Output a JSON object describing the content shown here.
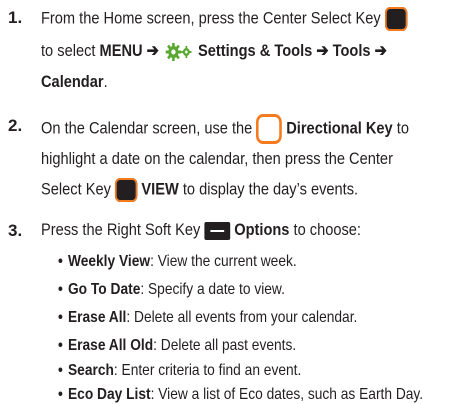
{
  "steps": [
    {
      "number": "1.",
      "pre": "From the Home screen, press the Center Select Key",
      "to_select": "to select",
      "menu": "MENU",
      "arrow": "➔",
      "settings": "Settings & Tools",
      "tools": "Tools",
      "calendar": "Calendar",
      "period": "."
    },
    {
      "number": "2.",
      "pre": "On the Calendar screen, use the",
      "directional": "Directional Key",
      "to": "to",
      "line2": "highlight a date on the calendar, then press the Center",
      "select_key": "Select Key",
      "view": "VIEW",
      "post": "to display the day’s events."
    },
    {
      "number": "3.",
      "pre": "Press the Right Soft Key",
      "options": "Options",
      "post": "to choose:"
    }
  ],
  "bullets": [
    {
      "term": "Weekly View",
      "desc": ": View the current week."
    },
    {
      "term": "Go To Date",
      "desc": ": Specify a date to view."
    },
    {
      "term": "Erase All",
      "desc": ": Delete all events from your calendar."
    },
    {
      "term": "Erase All Old",
      "desc": ": Delete all past events."
    },
    {
      "term": "Search",
      "desc": ": Enter criteria to find an event."
    },
    {
      "term": "Eco Day List",
      "desc": ": View a list of Eco dates, such as Earth Day."
    }
  ],
  "bullet_char": "•",
  "colors": {
    "key_orange": "#f47b20",
    "key_dark": "#231f20",
    "gear_green": "#5aa832"
  },
  "icons": [
    "center-select-key-icon",
    "settings-gear-icon",
    "directional-key-icon",
    "right-soft-key-icon"
  ]
}
